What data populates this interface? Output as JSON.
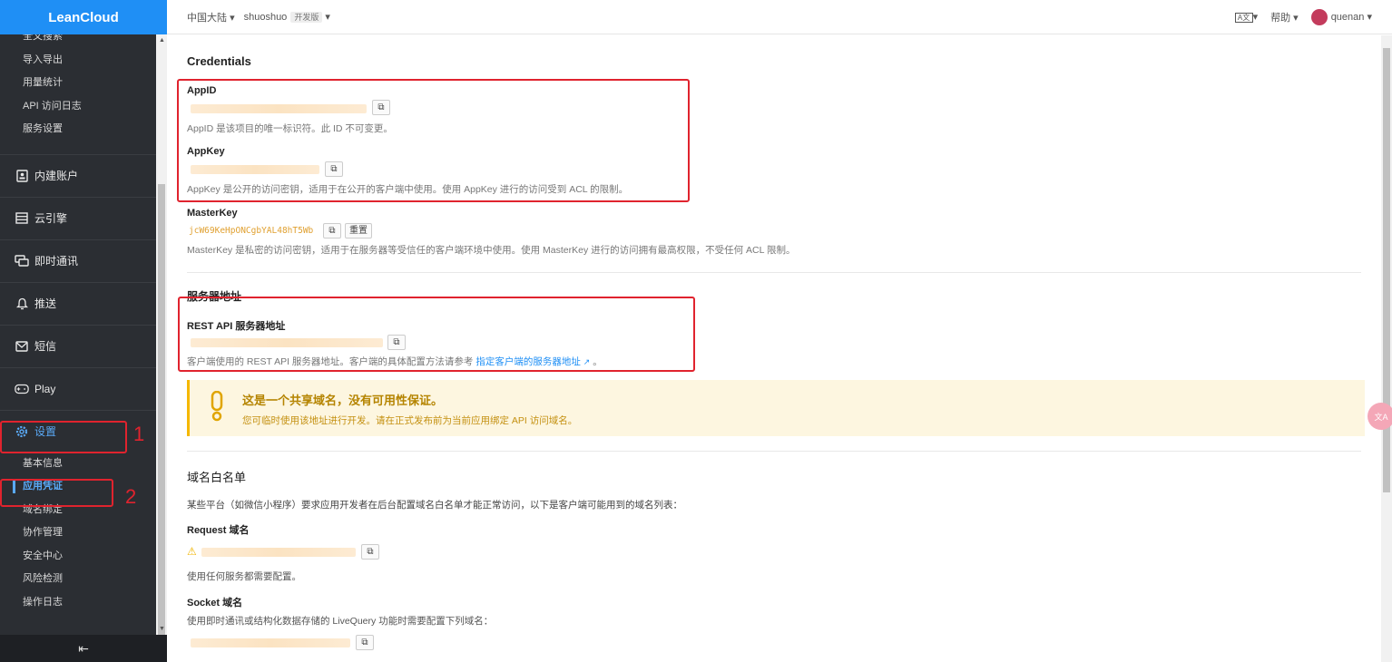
{
  "logo": "LeanCloud",
  "sidebar": {
    "top_items": [
      "全文搜索",
      "导入导出",
      "用量统计",
      "API 访问日志",
      "服务设置"
    ],
    "nav": [
      {
        "label": "内建账户",
        "icon": "account-icon"
      },
      {
        "label": "云引擎",
        "icon": "cloud-engine-icon"
      },
      {
        "label": "即时通讯",
        "icon": "chat-icon"
      },
      {
        "label": "推送",
        "icon": "bell-icon"
      },
      {
        "label": "短信",
        "icon": "mail-icon"
      },
      {
        "label": "Play",
        "icon": "gamepad-icon"
      },
      {
        "label": "设置",
        "icon": "gear-icon"
      }
    ],
    "settings_items": [
      "基本信息",
      "应用凭证",
      "域名绑定",
      "协作管理",
      "安全中心",
      "风险检测",
      "操作日志"
    ],
    "collapse_label": "⇤"
  },
  "header": {
    "region": "中国大陆",
    "app_name": "shuoshuo",
    "env_tag": "开发版",
    "lang_icon": "A文",
    "help": "帮助",
    "user": "quenan"
  },
  "credentials": {
    "title": "Credentials",
    "appid_label": "AppID",
    "appid_desc": "AppID 是该项目的唯一标识符。此 ID 不可变更。",
    "appkey_label": "AppKey",
    "appkey_desc": "AppKey 是公开的访问密钥，适用于在公开的客户端中使用。使用 AppKey 进行的访问受到 ACL 的限制。",
    "masterkey_label": "MasterKey",
    "masterkey_value": "jcW69KeHpONCgbYAL48hT5Wb",
    "reset_label": "重置",
    "masterkey_desc": "MasterKey 是私密的访问密钥，适用于在服务器等受信任的客户端环境中使用。使用 MasterKey 进行的访问拥有最高权限，不受任何 ACL 限制。"
  },
  "server": {
    "title": "服务器地址",
    "rest_label": "REST API 服务器地址",
    "rest_desc": "客户端使用的 REST API 服务器地址。客户端的具体配置方法请参考",
    "rest_link": "指定客户端的服务器地址",
    "rest_desc_end": "。"
  },
  "warning": {
    "title": "这是一个共享域名，没有可用性保证。",
    "text": "您可临时使用该地址进行开发。请在正式发布前为当前应用绑定 API 访问域名。"
  },
  "whitelist": {
    "title": "域名白名单",
    "intro": "某些平台（如微信小程序）要求应用开发者在后台配置域名白名单才能正常访问，以下是客户端可能用到的域名列表：",
    "request_label": "Request 域名",
    "request_desc": "使用任何服务都需要配置。",
    "socket_label": "Socket 域名",
    "socket_desc": "使用即时通讯或结构化数据存储的 LiveQuery 功能时需要配置下列域名："
  },
  "annotations": {
    "one": "1",
    "two": "2"
  },
  "float_button": "文A"
}
